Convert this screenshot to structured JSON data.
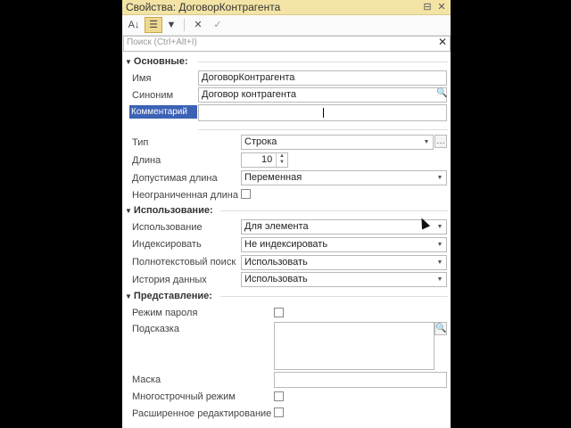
{
  "window": {
    "title": "Свойства: ДоговорКонтрагента",
    "pin_icon": "pin-icon",
    "close_icon": "close-icon"
  },
  "toolbar": {
    "sort_icon": "sort-az-icon",
    "categories_icon": "categories-icon",
    "filter_icon": "filter-icon",
    "delete_icon": "delete-icon",
    "apply_icon": "check-icon"
  },
  "search": {
    "placeholder": "Поиск (Ctrl+Alt+I)"
  },
  "groups": {
    "basic": {
      "label": "Основные:"
    },
    "usage": {
      "label": "Использование:"
    },
    "presentation": {
      "label": "Представление:"
    }
  },
  "basic": {
    "name_label": "Имя",
    "name_value": "ДоговорКонтрагента",
    "synonym_label": "Синоним",
    "synonym_value": "Договор контрагента",
    "comment_label": "Комментарий",
    "comment_value": ""
  },
  "type": {
    "type_label": "Тип",
    "type_value": "Строка",
    "length_label": "Длина",
    "length_value": "10",
    "allowed_length_label": "Допустимая длина",
    "allowed_length_value": "Переменная",
    "unlimited_length_label": "Неограниченная длина"
  },
  "usage": {
    "use_label": "Использование",
    "use_value": "Для элемента",
    "index_label": "Индексировать",
    "index_value": "Не индексировать",
    "fulltext_label": "Полнотекстовый поиск",
    "fulltext_value": "Использовать",
    "history_label": "История данных",
    "history_value": "Использовать"
  },
  "presentation": {
    "password_label": "Режим пароля",
    "tooltip_label": "Подсказка",
    "mask_label": "Маска",
    "multiline_label": "Многострочный режим",
    "extended_edit_label": "Расширенное редактирование"
  }
}
